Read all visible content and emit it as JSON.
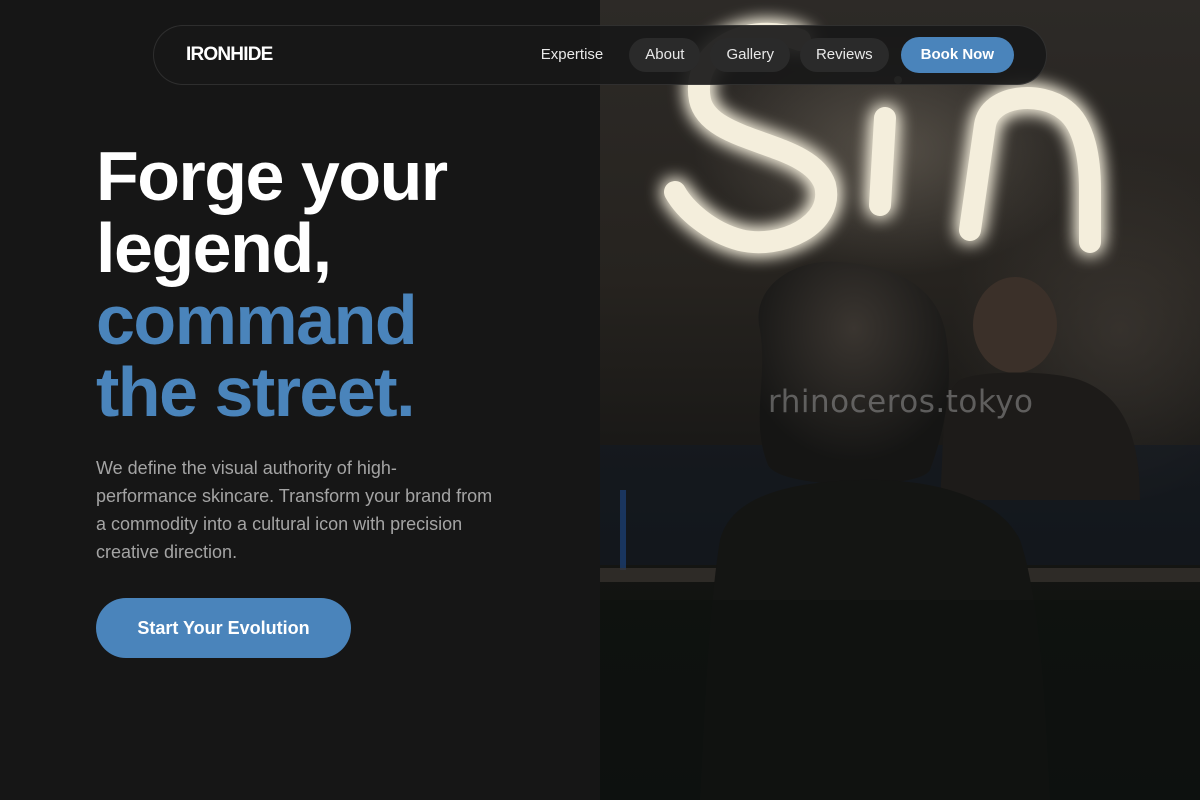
{
  "nav": {
    "logo": "IRONHIDE",
    "links": [
      {
        "label": "Expertise"
      },
      {
        "label": "About"
      },
      {
        "label": "Gallery"
      },
      {
        "label": "Reviews"
      }
    ],
    "cta": "Book Now"
  },
  "hero": {
    "title_lines": [
      "Forge your",
      "legend,"
    ],
    "accent_lines": [
      "command",
      "the street."
    ],
    "description": "We define the visual authority of high-performance skincare. Transform your brand from a commodity into a cultural icon with precision creative direction.",
    "cta": "Start Your Evolution"
  },
  "photo": {
    "neon_sign": "Sin",
    "watermark": "rhinoceros.tokyo"
  },
  "colors": {
    "background": "#161616",
    "accent": "#4a84bb",
    "text": "#ffffff",
    "muted": "#a4a4a4"
  }
}
